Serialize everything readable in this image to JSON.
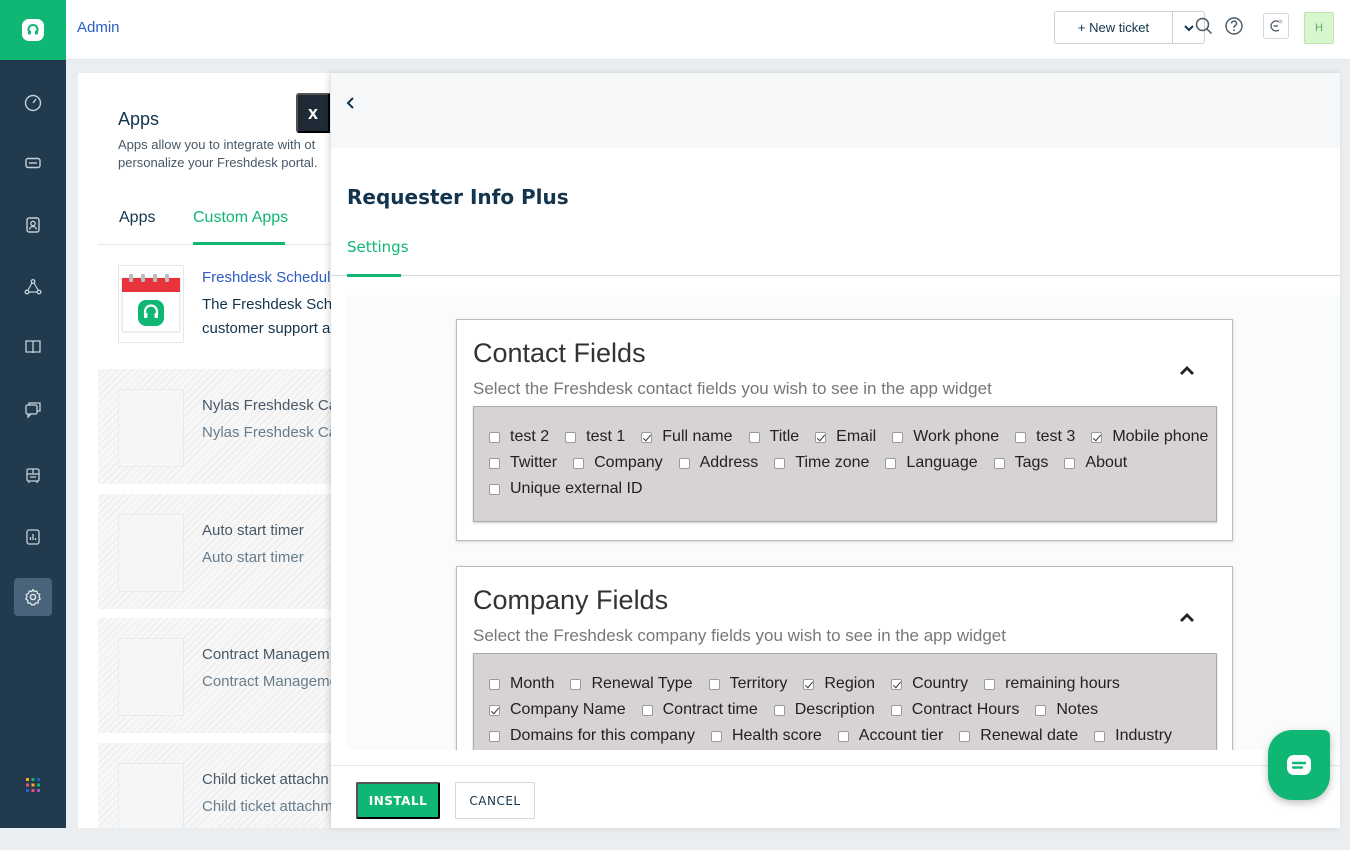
{
  "header": {
    "title": "Admin",
    "new_ticket_label": "+ New ticket",
    "avatar_initial": "H"
  },
  "apps_panel": {
    "title": "Apps",
    "description_line1": "Apps allow you to integrate with ot",
    "description_line2": "personalize your Freshdesk portal.",
    "tabs": [
      {
        "label": "Apps",
        "active": false
      },
      {
        "label": "Custom Apps",
        "active": true
      }
    ],
    "apps": [
      {
        "name": "Freshdesk Scheduli",
        "desc1": "The Freshdesk Sche",
        "desc2": "customer support a"
      },
      {
        "name": "Nylas Freshdesk Ca",
        "desc1": "Nylas Freshdesk Cal"
      },
      {
        "name": "Auto start timer",
        "desc1": "Auto start timer"
      },
      {
        "name": "Contract Managem",
        "desc1": "Contract Manageme"
      },
      {
        "name": "Child ticket attachn",
        "desc1": "Child ticket attachm"
      }
    ]
  },
  "close_label": "x",
  "drawer": {
    "title": "Requester Info Plus",
    "tab_label": "Settings",
    "install_label": "INSTALL",
    "cancel_label": "CANCEL"
  },
  "contact_fields": {
    "title": "Contact Fields",
    "subtitle": "Select the Freshdesk contact fields you wish to see in the app widget",
    "rows": [
      [
        {
          "label": "test 2",
          "checked": false
        },
        {
          "label": "test 1",
          "checked": false
        },
        {
          "label": "Full name",
          "checked": true
        },
        {
          "label": "Title",
          "checked": false
        },
        {
          "label": "Email",
          "checked": true
        },
        {
          "label": "Work phone",
          "checked": false
        },
        {
          "label": "test 3",
          "checked": false
        },
        {
          "label": "Mobile phone",
          "checked": true
        }
      ],
      [
        {
          "label": "Twitter",
          "checked": false
        },
        {
          "label": "Company",
          "checked": false
        },
        {
          "label": "Address",
          "checked": false
        },
        {
          "label": "Time zone",
          "checked": false
        },
        {
          "label": "Language",
          "checked": false
        },
        {
          "label": "Tags",
          "checked": false
        },
        {
          "label": "About",
          "checked": false
        }
      ],
      [
        {
          "label": "Unique external ID",
          "checked": false
        }
      ]
    ]
  },
  "company_fields": {
    "title": "Company Fields",
    "subtitle": "Select the Freshdesk company fields you wish to see in the app widget",
    "rows": [
      [
        {
          "label": "Month",
          "checked": false
        },
        {
          "label": "Renewal Type",
          "checked": false
        },
        {
          "label": "Territory",
          "checked": false
        },
        {
          "label": "Region",
          "checked": true
        },
        {
          "label": "Country",
          "checked": true
        },
        {
          "label": "remaining hours",
          "checked": false
        }
      ],
      [
        {
          "label": "Company Name",
          "checked": true
        },
        {
          "label": "Contract time",
          "checked": false
        },
        {
          "label": "Description",
          "checked": false
        },
        {
          "label": "Contract Hours",
          "checked": false
        },
        {
          "label": "Notes",
          "checked": false
        }
      ],
      [
        {
          "label": "Domains for this company",
          "checked": false
        },
        {
          "label": "Health score",
          "checked": false
        },
        {
          "label": "Account tier",
          "checked": false
        },
        {
          "label": "Renewal date",
          "checked": false
        },
        {
          "label": "Industry",
          "checked": false
        }
      ]
    ]
  },
  "colors": {
    "brand_green": "#10b674",
    "nav_bg": "#213a4d",
    "link_blue": "#2c5cc5"
  }
}
